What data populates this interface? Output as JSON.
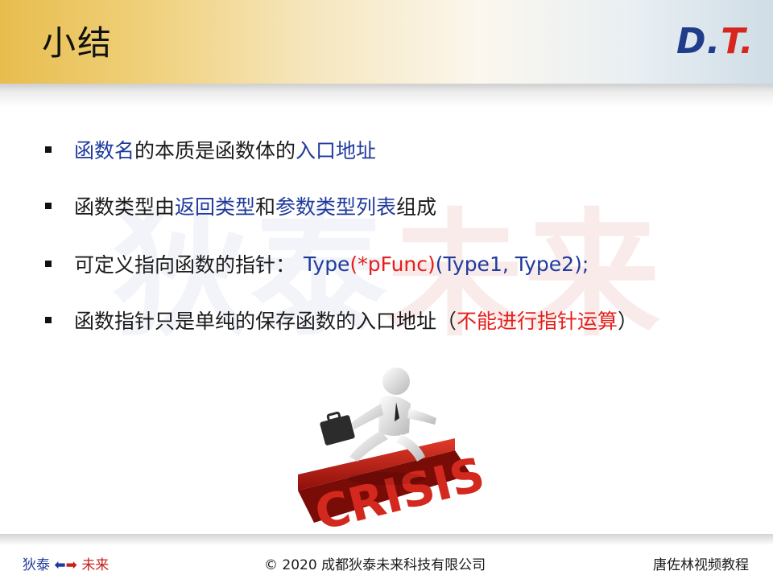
{
  "slide": {
    "title": "小结",
    "logo": {
      "d": "D",
      "dot1": ".",
      "t": "T",
      "dot2": "."
    },
    "watermark": {
      "part1": "狄泰",
      "part2": "未来"
    }
  },
  "bullets": [
    {
      "segments": [
        {
          "text": "函数名",
          "color": "blue"
        },
        {
          "text": "的本质是函数体的",
          "color": "dark"
        },
        {
          "text": "入口地址",
          "color": "blue"
        }
      ]
    },
    {
      "segments": [
        {
          "text": "函数类型由 ",
          "color": "dark"
        },
        {
          "text": "返回类型",
          "color": "blue"
        },
        {
          "text": " 和 ",
          "color": "dark"
        },
        {
          "text": "参数类型列表",
          "color": "blue"
        },
        {
          "text": " 组成",
          "color": "dark"
        }
      ]
    },
    {
      "segments": [
        {
          "text": "可定义指向函数的指针：",
          "color": "dark"
        },
        {
          "text": "Type ",
          "color": "blue"
        },
        {
          "text": "(*pFunc)",
          "color": "red"
        },
        {
          "text": " (Type1, Type2);",
          "color": "blue"
        }
      ]
    },
    {
      "segments": [
        {
          "text": "函数指针只是单纯的保存函数的入口地址（",
          "color": "dark"
        },
        {
          "text": "不能进行指针运算",
          "color": "red"
        },
        {
          "text": "）",
          "color": "dark"
        }
      ]
    }
  ],
  "illustration": {
    "icon": "businessman-jumping-crisis-icon",
    "word": "CRISIS"
  },
  "footer": {
    "left_part1": "狄泰",
    "left_arrows": "⬅➡",
    "left_part2": "未来",
    "center": "© 2020 成都狄泰未来科技有限公司",
    "right": "唐佐林视频教程"
  },
  "colors": {
    "blue": "#1f3a9c",
    "red": "#e3201b",
    "header_gold": "#e7bd4e"
  }
}
